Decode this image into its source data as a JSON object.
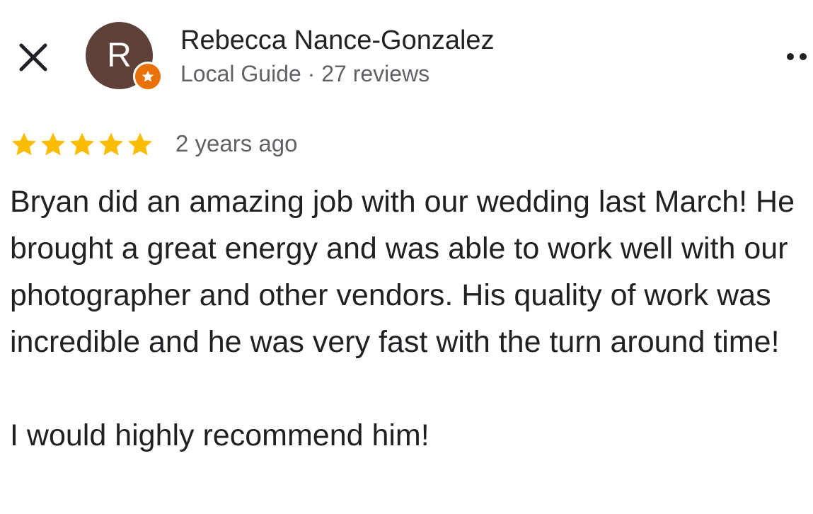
{
  "header": {
    "close_icon": "close-icon",
    "more_icon": "more-options-icon"
  },
  "reviewer": {
    "avatar_initial": "R",
    "avatar_color": "#5d4037",
    "badge_icon": "local-guide-star-icon",
    "badge_color": "#e8710a",
    "name": "Rebecca Nance-Gonzalez",
    "meta": "Local Guide · 27 reviews"
  },
  "review": {
    "rating": 5,
    "rating_max": 5,
    "star_color": "#fbbc04",
    "date": "2 years ago",
    "paragraph_1": "Bryan did an amazing job with our wedding last March! He brought a great energy and was able to work well with our photographer and other vendors. His quality of work was incredible and he was very fast with the turn around time!",
    "paragraph_2": "I would highly recommend him!"
  }
}
